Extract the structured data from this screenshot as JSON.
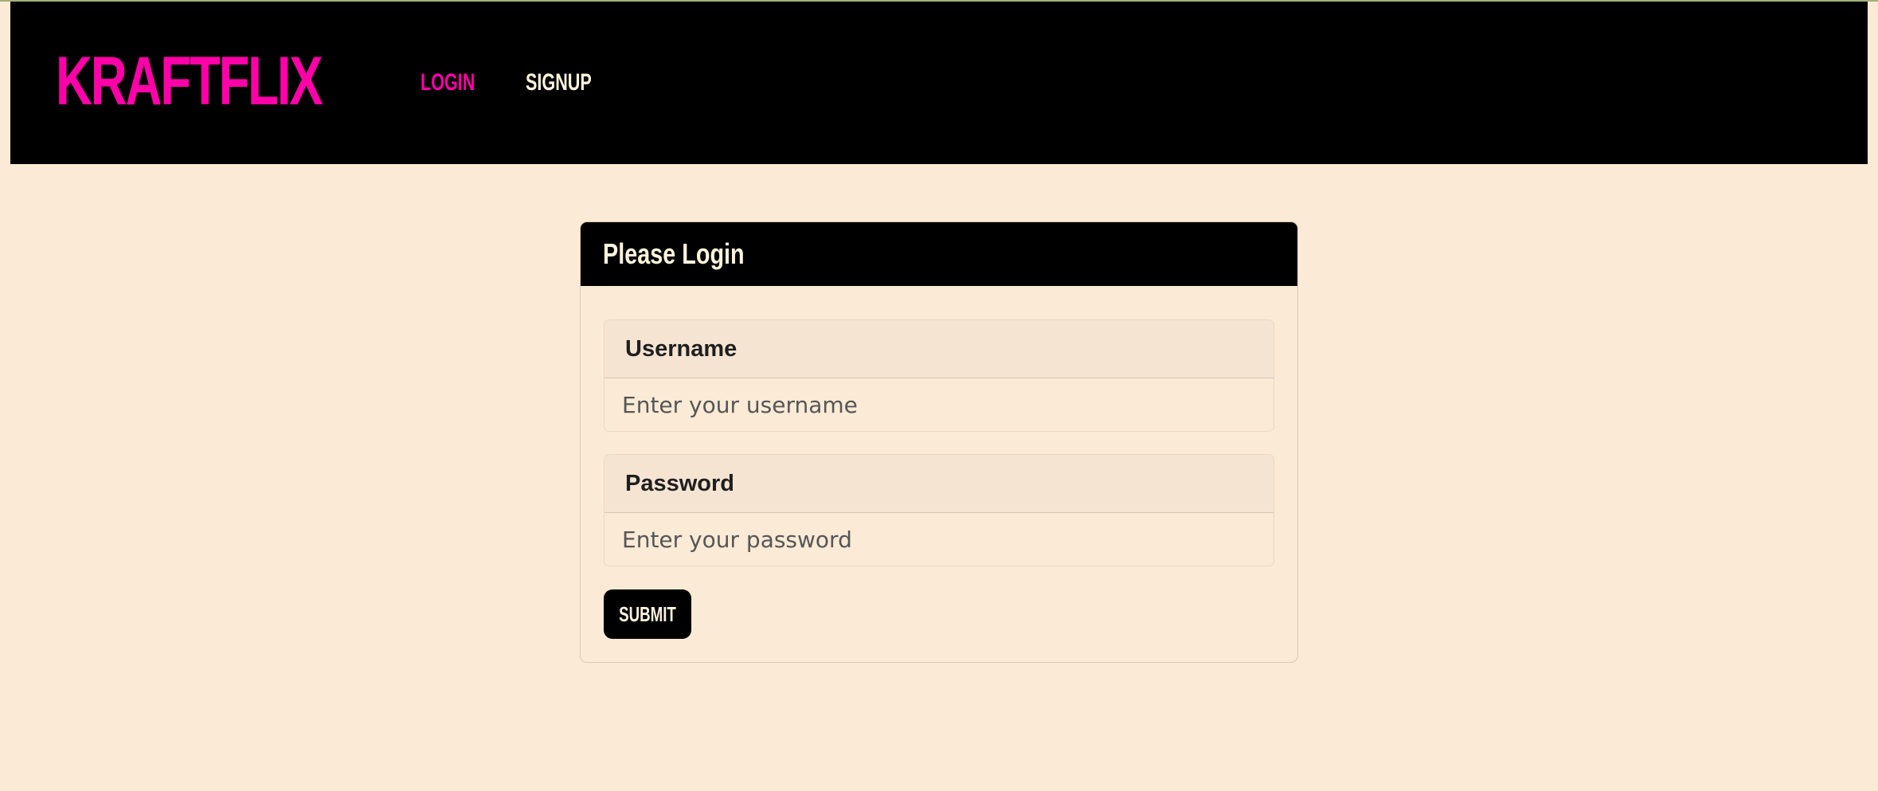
{
  "navbar": {
    "brand": "KRAFTFLIX",
    "links": [
      {
        "label": "LOGIN",
        "active": true
      },
      {
        "label": "SIGNUP",
        "active": false
      }
    ]
  },
  "login_card": {
    "title": "Please Login",
    "fields": [
      {
        "label": "Username",
        "placeholder": "Enter your username",
        "value": ""
      },
      {
        "label": "Password",
        "placeholder": "Enter your password",
        "value": ""
      }
    ],
    "submit_label": "SUBMIT"
  },
  "colors": {
    "page_background": "#faead6",
    "navbar_background": "#000000",
    "brand_accent": "#ff00a8",
    "nav_text": "#fff3dc",
    "label_box_background": "#f5e4d2"
  }
}
